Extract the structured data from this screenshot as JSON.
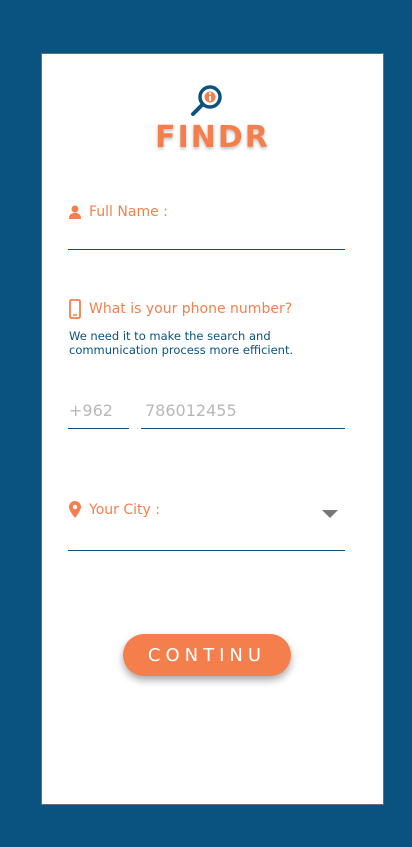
{
  "brand": {
    "name": "FINDR",
    "colors": {
      "accent": "#f47f4d",
      "primary": "#0a5280"
    },
    "icon": "magnifier-info-icon"
  },
  "form": {
    "full_name": {
      "label": "Full Name :",
      "icon": "user-icon"
    },
    "phone": {
      "label": "What is your phone number?",
      "icon": "smartphone-icon",
      "helper": "We need it to make the search and communication process more efficient.",
      "country_code_placeholder": "+962",
      "number_placeholder": "786012455"
    },
    "city": {
      "label": "Your City :",
      "icon": "location-pin-icon",
      "dropdown_icon": "caret-down-icon"
    }
  },
  "actions": {
    "continue_label": "CONTINU"
  }
}
